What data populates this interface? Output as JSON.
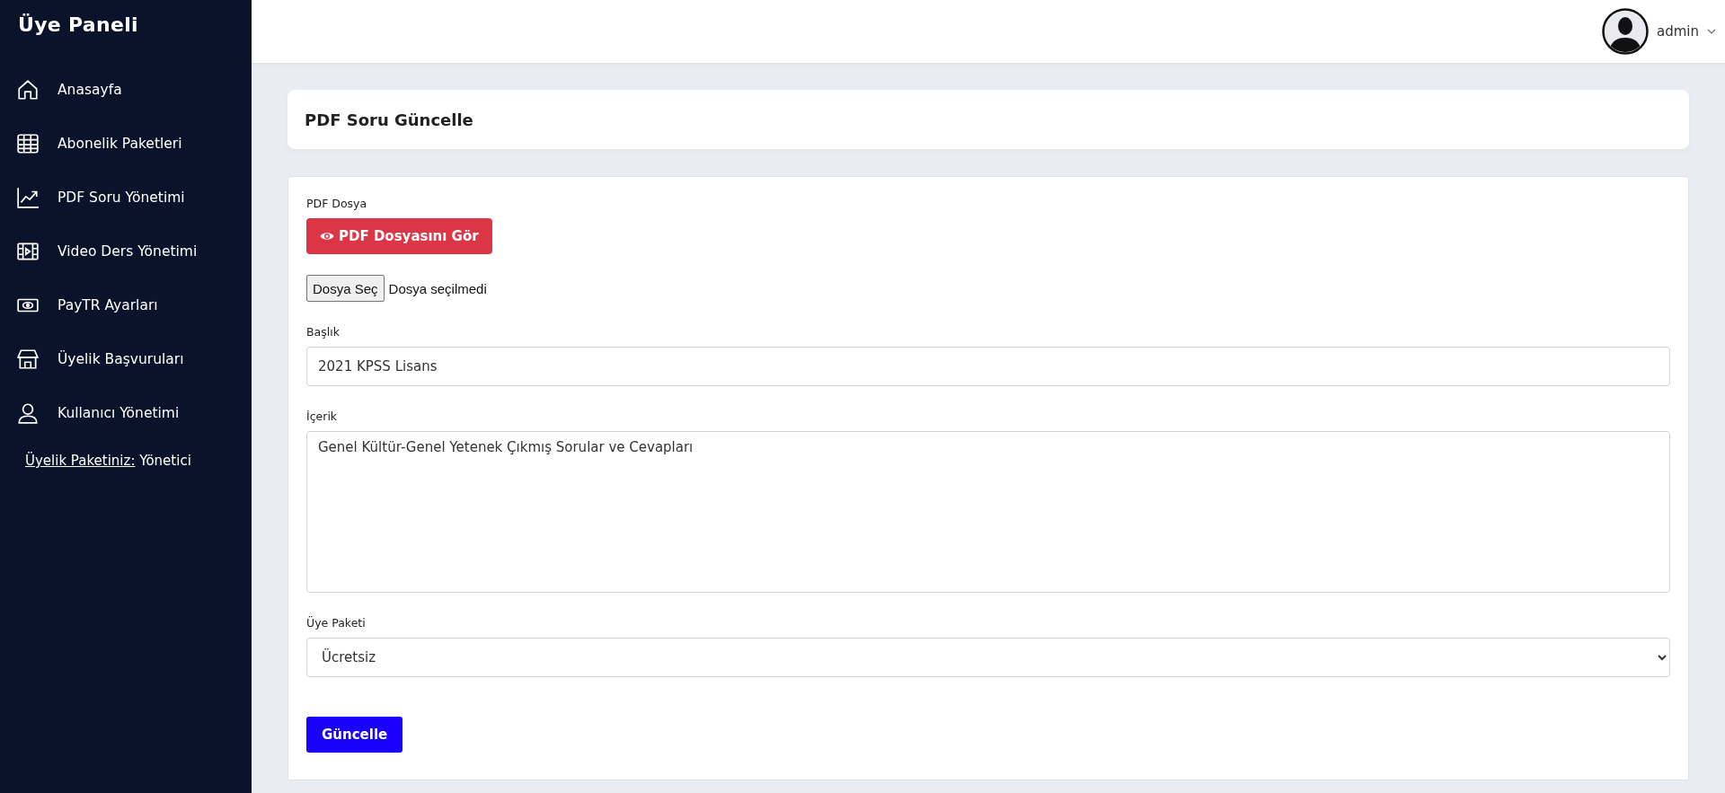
{
  "sidebar": {
    "title": "Üye Paneli",
    "items": [
      {
        "label": "Anasayfa",
        "selected": false
      },
      {
        "label": "Abonelik Paketleri",
        "selected": false
      },
      {
        "label": "PDF Soru Yönetimi",
        "selected": false
      },
      {
        "label": "Video Ders Yönetimi",
        "selected": false
      },
      {
        "label": "PayTR Ayarları",
        "selected": false
      },
      {
        "label": "Üyelik Başvuruları",
        "selected": false
      },
      {
        "label": "Kullanıcı Yönetimi",
        "selected": false
      }
    ],
    "membership": {
      "label": "Üyelik Paketiniz:",
      "value": "Yönetici"
    }
  },
  "topbar": {
    "user": "admin"
  },
  "page_title": "PDF Soru Güncelle",
  "form": {
    "pdf_label": "PDF Dosya",
    "view_button": "PDF Dosyasını Gör",
    "file_button": "Dosya Seç",
    "file_status": "Dosya seçilmedi",
    "title_label": "Başlık",
    "title_value": "2021 KPSS Lisans",
    "content_label": "İçerik",
    "content_value": "Genel Kültür-Genel Yetenek Çıkmış Sorular ve Cevapları",
    "package_label": "Üye Paketi",
    "package_value": "Ücretsiz",
    "submit": "Güncelle"
  }
}
